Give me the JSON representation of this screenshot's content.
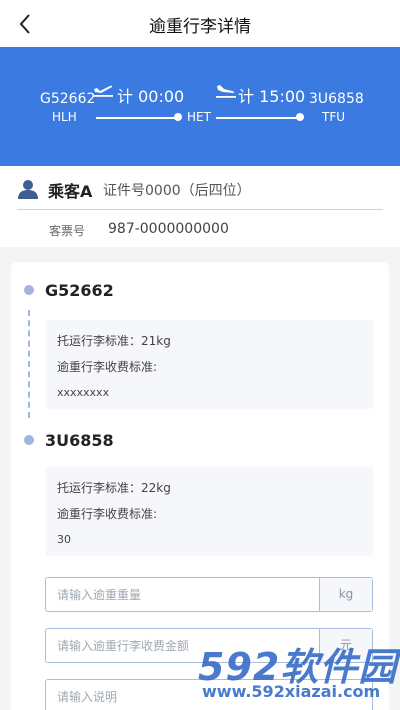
{
  "nav": {
    "title": "逾重行李详情"
  },
  "flight": {
    "dep_code": "G52662",
    "dep_city": "HLH",
    "dep_time": "计 00:00",
    "mid_city": "HET",
    "arr_time": "计 15:00",
    "arr_code": "3U6858",
    "arr_city": "TFU"
  },
  "passenger": {
    "name": "乘客A",
    "id_text": "证件号0000（后四位）",
    "ticket_label": "客票号",
    "ticket_no": "987-0000000000"
  },
  "segments": [
    {
      "flight": "G52662",
      "allowance": "托运行李标准：21kg",
      "fee_label": "逾重行李收费标准:",
      "fee_value": "xxxxxxxx"
    },
    {
      "flight": "3U6858",
      "allowance": "托运行李标准：22kg",
      "fee_label": "逾重行李收费标准:",
      "fee_value": "30"
    }
  ],
  "form": {
    "weight_placeholder": "请输入逾重重量",
    "weight_unit": "kg",
    "fee_placeholder": "请输入逾重行李收费金额",
    "fee_unit": "元",
    "note_placeholder": "请输入说明"
  },
  "watermark": {
    "big": "592软件园",
    "small": "www.592xiazai.com"
  },
  "colors": {
    "accent": "#3b7ae0",
    "timeline": "#9fb6e0",
    "watermark": "#3a6fc7"
  }
}
